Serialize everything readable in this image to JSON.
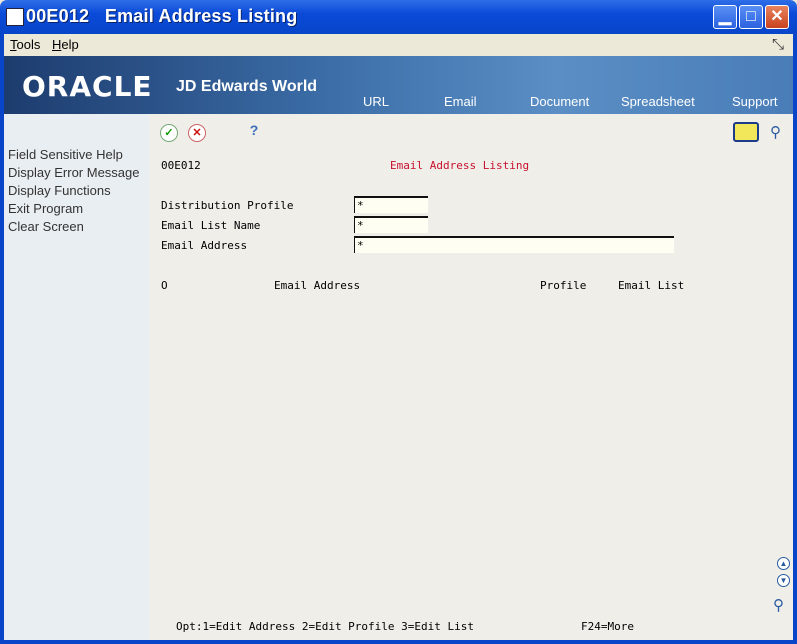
{
  "window": {
    "title": "00E012",
    "app_name": "Email Address Listing"
  },
  "menubar": {
    "tools": "Tools",
    "tools_u": "T",
    "tools_rest": "ools",
    "help": "Help",
    "help_u": "H",
    "help_rest": "elp"
  },
  "banner": {
    "brand": "ORACLE",
    "product": "JD Edwards World",
    "links": [
      "URL",
      "Email",
      "Document",
      "Spreadsheet",
      "Support"
    ]
  },
  "sidebar": {
    "items": [
      "Field Sensitive Help",
      "Display Error Message",
      "Display Functions",
      "Exit Program",
      "Clear Screen"
    ]
  },
  "toolbar": {
    "ok_icon": "checkmark-icon",
    "cancel_icon": "x-icon",
    "help_glyph": "?"
  },
  "form": {
    "program_id": "00E012",
    "title": "Email Address Listing",
    "fields": [
      {
        "label": "Distribution Profile",
        "value": "*"
      },
      {
        "label": "Email List Name",
        "value": "*"
      },
      {
        "label": "Email Address",
        "value": "*"
      }
    ]
  },
  "grid": {
    "columns": [
      "O",
      "Email Address",
      "Profile",
      "Email List"
    ]
  },
  "footer": {
    "options": "Opt:1=Edit Address  2=Edit Profile  3=Edit List",
    "more": "F24=More"
  },
  "colors": {
    "title_bar": "#0a4ad8",
    "form_title": "#c8102e",
    "content_bg": "#f0eee9"
  }
}
